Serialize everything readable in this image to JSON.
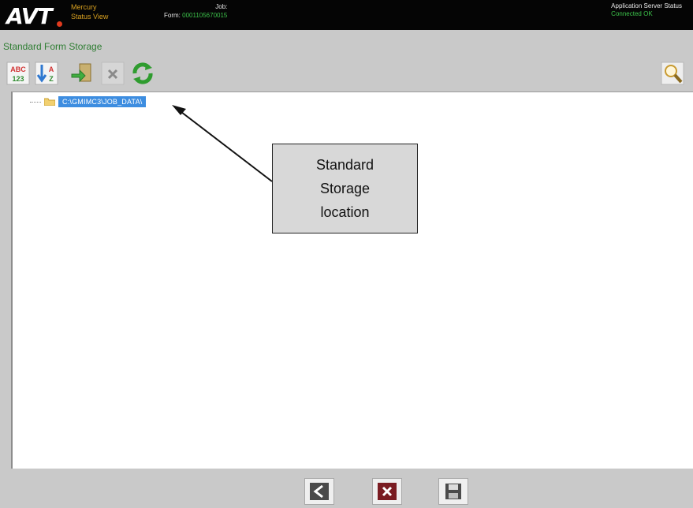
{
  "header": {
    "logo_text": "AVT",
    "app_line1": "Mercury",
    "app_line2": "Status View",
    "job_label": "Job:",
    "form_label": "Form:",
    "form_value": "0001105670015",
    "server_label": "Application Server Status",
    "server_value": "Connected OK"
  },
  "panel": {
    "title": "Standard Form Storage"
  },
  "toolbar": {
    "abc_text_top": "ABC",
    "abc_text_bottom": "123",
    "az_text_top": "A",
    "az_text_bottom": "Z"
  },
  "tree": {
    "root_label": "C:\\GMIMC3\\JOB_DATA\\"
  },
  "callout": {
    "line1": "Standard",
    "line2": "Storage",
    "line3": "location"
  },
  "colors": {
    "header_bg": "#050505",
    "app_name": "#d8a020",
    "status_green": "#3cc24a",
    "panel_bg": "#c9c9c9",
    "title_green": "#2e7d32",
    "selection_blue": "#3d8de0"
  }
}
